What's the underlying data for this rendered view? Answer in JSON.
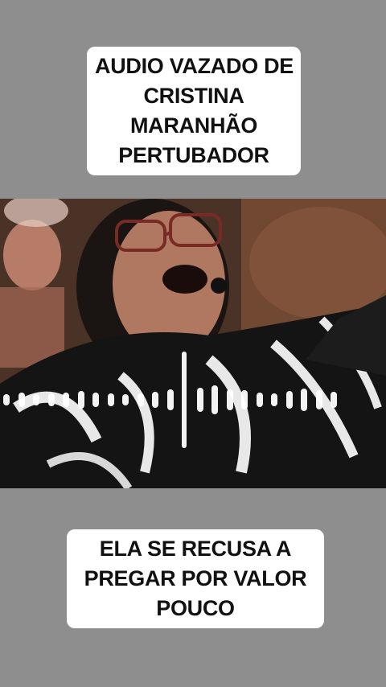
{
  "top_caption": {
    "lines": [
      "AUDIO VAZADO DE",
      "CRISTINA",
      "MARANHÃO",
      "PERTUBADOR"
    ]
  },
  "bottom_caption": {
    "lines": [
      "ELA SE RECUSA A",
      "PREGAR POR VALOR",
      "POUCO"
    ]
  },
  "colors": {
    "background": "#8e8e8e",
    "caption_bg": "#ffffff",
    "caption_text": "#111111",
    "waveform": "#ffffff"
  },
  "waveform_icon": "audio-waveform-icon"
}
